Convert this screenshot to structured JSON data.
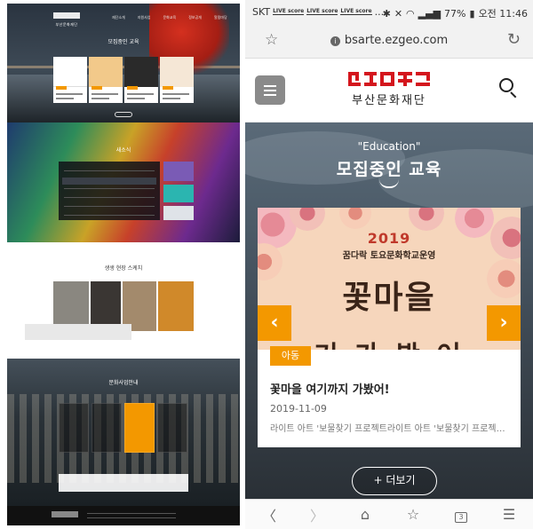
{
  "desktop": {
    "logo_sub": "부산문화재단",
    "menu": [
      "재단소개",
      "지원사업",
      "문화교육",
      "정보공개",
      "알림마당"
    ],
    "sections": {
      "education_title": "모집중인 교육",
      "notice_title": "새소식",
      "space_title": "생생 현장 스케치",
      "culture_title": "문화사업안내"
    }
  },
  "mobile": {
    "status": {
      "carrier": "SKT",
      "live_badges": [
        "LIVE score",
        "LIVE score",
        "LIVE score"
      ],
      "overflow": "...",
      "battery": "77%",
      "time": "오전 11:46"
    },
    "browser": {
      "url": "bsarte.ezgeo.com"
    },
    "header": {
      "brand_ko": "부산문화재단"
    },
    "hero": {
      "subtitle": "\"Education\"",
      "title": "모집중인 교육"
    },
    "card": {
      "poster_year": "2019",
      "poster_program": "꿈다락 토요문화학교운영",
      "poster_big": "꽃마을",
      "poster_big2": "기 가 봤 어",
      "badge": "아동",
      "title": "꽃마을 여기까지 가봤어!",
      "date": "2019-11-09",
      "description": "라이트 아트 '보물찾기 프로젝트라이트 아트 '보물찾기 프로젝…"
    },
    "more_button": "+ 더보기",
    "nav": {
      "tab_count": "3"
    }
  },
  "colors": {
    "brand_red": "#d4161d",
    "accent_orange": "#f39800"
  }
}
